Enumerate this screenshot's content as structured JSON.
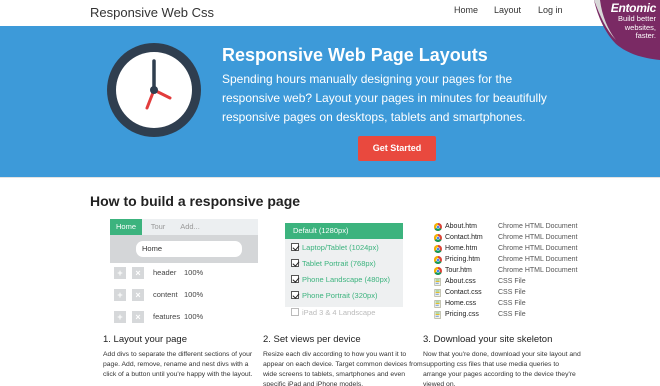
{
  "nav": {
    "brand": "Responsive Web Css",
    "links": [
      "Home",
      "Layout",
      "Log in"
    ]
  },
  "corner": {
    "logo": "Entomic",
    "tagline": [
      "Build better",
      "websites,",
      "faster."
    ]
  },
  "hero": {
    "title": "Responsive Web Page Layouts",
    "text": "Spending hours manually designing your pages for the responsive web? Layout your pages in minutes for beautifully responsive pages on desktops, tablets and smartphones.",
    "cta_label": "Get Started",
    "colors": {
      "background": "#3d9ad9",
      "cta": "#e9493e",
      "clock_hand": "#e23c3c"
    }
  },
  "section_title": "How to build a responsive page",
  "editor": {
    "tabs": [
      "Home",
      "Tour",
      "Add..."
    ],
    "active_tab": "Home",
    "input_value": "Home",
    "rows": [
      {
        "label": "header",
        "pct": "100%"
      },
      {
        "label": "content",
        "pct": "100%"
      },
      {
        "label": "features",
        "pct": "100%"
      }
    ],
    "add_icon": "+",
    "remove_icon": "×"
  },
  "sizes": {
    "header": "Default (1280px)",
    "items": [
      {
        "label": "Laptop/Tablet (1024px)",
        "checked": true
      },
      {
        "label": "Tablet Portrait (768px)",
        "checked": true
      },
      {
        "label": "Phone Landscape (480px)",
        "checked": true
      },
      {
        "label": "Phone Portrait (320px)",
        "checked": true
      },
      {
        "label": "iPad 3 & 4 Landscape",
        "checked": false
      }
    ]
  },
  "files": [
    {
      "name": "About.htm",
      "type": "Chrome HTML Document",
      "icon": "chrome-icon"
    },
    {
      "name": "Contact.htm",
      "type": "Chrome HTML Document",
      "icon": "chrome-icon"
    },
    {
      "name": "Home.htm",
      "type": "Chrome HTML Document",
      "icon": "chrome-icon"
    },
    {
      "name": "Pricing.htm",
      "type": "Chrome HTML Document",
      "icon": "chrome-icon"
    },
    {
      "name": "Tour.htm",
      "type": "Chrome HTML Document",
      "icon": "chrome-icon"
    },
    {
      "name": "About.css",
      "type": "CSS File",
      "icon": "css-file-icon"
    },
    {
      "name": "Contact.css",
      "type": "CSS File",
      "icon": "css-file-icon"
    },
    {
      "name": "Home.css",
      "type": "CSS File",
      "icon": "css-file-icon"
    },
    {
      "name": "Pricing.css",
      "type": "CSS File",
      "icon": "css-file-icon"
    }
  ],
  "steps": [
    {
      "heading": "1. Layout your page",
      "text": "Add divs to separate the different sections of your page. Add, remove, rename and nest divs with a click of a button until you're happy with the layout."
    },
    {
      "heading": "2. Set views per device",
      "text": "Resize each div according to how you want it to appear on each device. Target common devices from wide screens to tablets, smartphones and even specific iPad and iPhone models."
    },
    {
      "heading": "3. Download your site skeleton",
      "text": "Now that you're done, download your site layout and supporting css files that use media queries to arrange your pages according to the device they're viewed on."
    }
  ]
}
